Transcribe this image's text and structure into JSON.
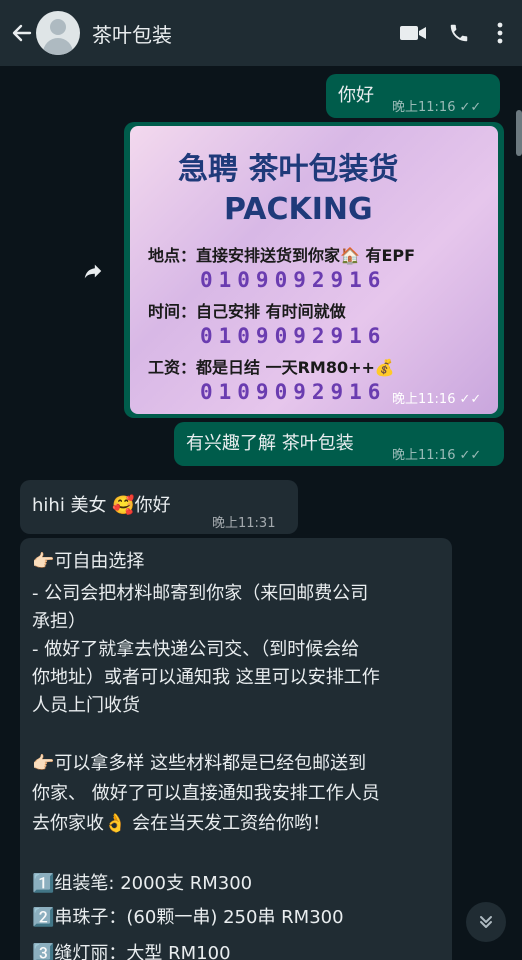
{
  "header": {
    "title": "茶叶包装"
  },
  "messages": {
    "m1": {
      "text": "你好",
      "time": "晚上11:16"
    },
    "poster": {
      "title1": "急聘 茶叶包装货",
      "title2": "PACKING",
      "line1": "地点：直接安排送货到你家🏠 有EPF",
      "num1": "0109092916",
      "line2": "时间：自己安排 有时间就做",
      "num2": "0109092916",
      "line3": "工资：都是日结 一天RM80++💰",
      "num3": "0109092916",
      "time": "晚上11:16"
    },
    "m3": {
      "text": "有兴趣了解 茶叶包装",
      "time": "晚上11:16"
    },
    "m4": {
      "text": "hihi 美女 🥰你好",
      "time": "晚上11:31"
    },
    "m5": {
      "l1": "👉🏻可自由选择",
      "l2": "- 公司会把材料邮寄到你家（来回邮费公司",
      "l3": "承担）",
      "l4": "- 做好了就拿去快递公司交、（到时候会给",
      "l5": "你地址）或者可以通知我 这里可以安排工作",
      "l6": "人员上门收货",
      "l7": "👉🏻可以拿多样 这些材料都是已经包邮送到",
      "l8": "你家、 做好了可以直接通知我安排工作人员",
      "l9": "去你家收👌 会在当天发工资给你哟！",
      "l10": "1️⃣组装笔: 2000支 RM300",
      "l11": "2️⃣串珠子：(60颗一串) 250串 RM300",
      "l12": "3️⃣缝灯丽：大型 RM100"
    }
  }
}
